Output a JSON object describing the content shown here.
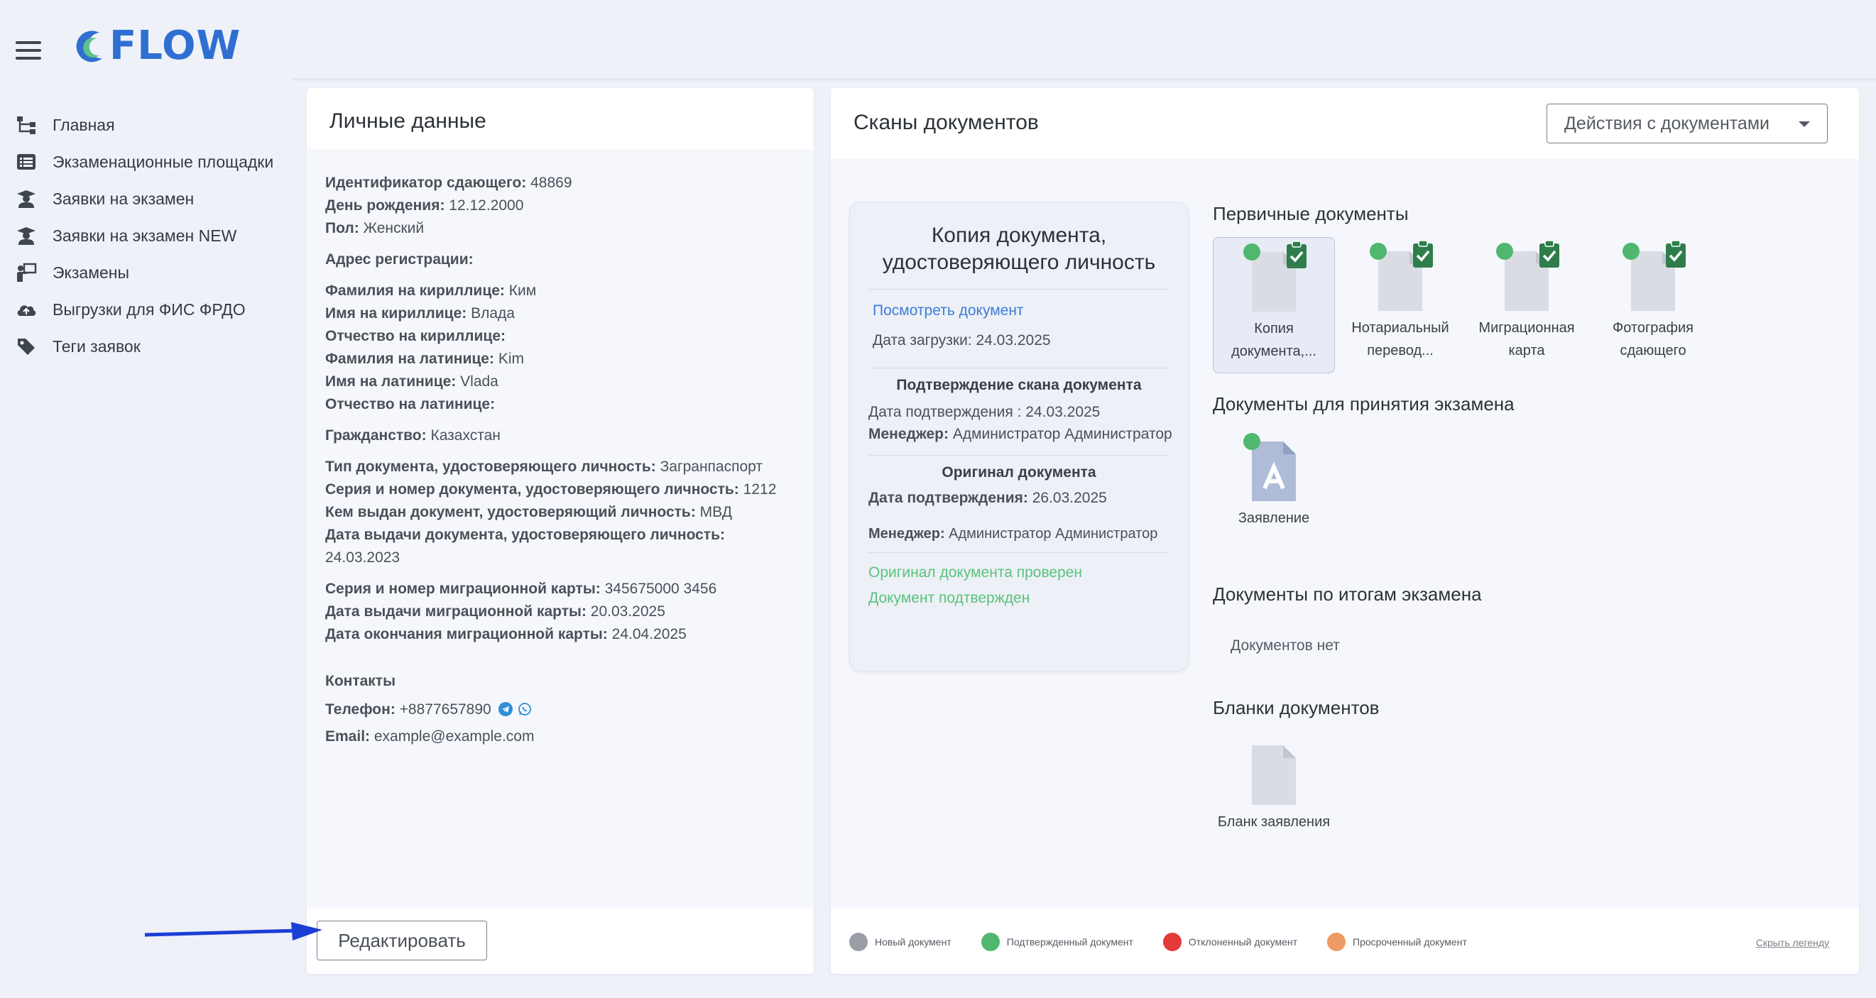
{
  "app": {
    "logo_text": "FLOW",
    "brand_color": "#2f6fd1"
  },
  "sidebar": {
    "items": [
      {
        "label": "Главная",
        "icon": "sitemap-icon"
      },
      {
        "label": "Экзаменационные площадки",
        "icon": "list-icon"
      },
      {
        "label": "Заявки на экзамен",
        "icon": "user-graduate-icon"
      },
      {
        "label": "Заявки на экзамен NEW",
        "icon": "user-graduate-icon"
      },
      {
        "label": "Экзамены",
        "icon": "teacher-board-icon"
      },
      {
        "label": "Выгрузки для ФИС ФРДО",
        "icon": "cloud-upload-icon"
      },
      {
        "label": "Теги заявок",
        "icon": "tag-icon"
      }
    ]
  },
  "personal": {
    "title": "Личные данные",
    "id_label": "Идентификатор сдающего:",
    "id_value": "48869",
    "birthday_label": "День рождения:",
    "birthday_value": "12.12.2000",
    "gender_label": "Пол:",
    "gender_value": "Женский",
    "address_label": "Адрес регистрации:",
    "last_cyr_label": "Фамилия на кириллице:",
    "last_cyr_value": "Ким",
    "first_cyr_label": "Имя на кириллице:",
    "first_cyr_value": "Влада",
    "patr_cyr_label": "Отчество на кириллице:",
    "last_lat_label": "Фамилия на латинице:",
    "last_lat_value": "Kim",
    "first_lat_label": "Имя на латинице:",
    "first_lat_value": "Vlada",
    "patr_lat_label": "Отчество на латинице:",
    "citizenship_label": "Гражданство:",
    "citizenship_value": "Казахстан",
    "doc_type_label": "Тип документа, удостоверяющего личность:",
    "doc_type_value": "Загранпаспорт",
    "doc_number_label": "Серия и номер документа, удостоверяющего личность:",
    "doc_number_value": "1212",
    "issued_by_label": "Кем выдан документ, удостоверяющий личность:",
    "issued_by_value": "МВД",
    "issue_date_label": "Дата выдачи документа, удостоверяющего личность:",
    "issue_date_value": "24.03.2023",
    "mig_number_label": "Серия и номер миграционной карты:",
    "mig_number_value": "345675000 3456",
    "mig_issue_label": "Дата выдачи миграционной карты:",
    "mig_issue_value": "20.03.2025",
    "mig_end_label": "Дата окончания миграционной карты:",
    "mig_end_value": "24.04.2025",
    "contacts_title": "Контакты",
    "phone_label": "Телефон:",
    "phone_value": "+8877657890",
    "email_label": "Email:",
    "email_value": "example@example.com",
    "edit_button": "Редактировать"
  },
  "scans": {
    "title": "Сканы документов",
    "actions_button": "Действия с документами",
    "detail": {
      "title_line1": "Копия документа,",
      "title_line2": "удостоверяющего личность",
      "view_link": "Посмотреть документ",
      "upload_date": "Дата загрузки: 24.03.2025",
      "scan_confirm_title": "Подтверждение скана документа",
      "scan_confirm_date": "Дата подтверждения : 24.03.2025",
      "manager_label": "Менеджер:",
      "scan_manager": "Администратор Администратор",
      "original_title": "Оригинал документа",
      "original_date_label": "Дата подтверждения:",
      "original_date_value": "26.03.2025",
      "original_manager": "Администратор Администратор",
      "status_checked": "Оригинал документа проверен",
      "status_confirmed": "Документ подтвержден"
    },
    "primary": {
      "title": "Первичные документы",
      "docs": [
        {
          "label_1": "Копия",
          "label_2": "документа,..."
        },
        {
          "label_1": "Нотариальный",
          "label_2": "перевод..."
        },
        {
          "label_1": "Миграционная",
          "label_2": "карта"
        },
        {
          "label_1": "Фотография",
          "label_2": "сдающего"
        }
      ]
    },
    "exam_docs": {
      "title": "Документы для принятия экзамена",
      "docs": [
        {
          "label": "Заявление"
        }
      ]
    },
    "result_docs": {
      "title": "Документы по итогам экзамена",
      "empty": "Документов нет"
    },
    "blanks": {
      "title": "Бланки документов",
      "docs": [
        {
          "label": "Бланк заявления"
        }
      ]
    },
    "legend": {
      "items": [
        {
          "label": "Новый документ",
          "color": "#9a9ea6"
        },
        {
          "label": "Подтвержденный документ",
          "color": "#4fb86e"
        },
        {
          "label": "Отклоненный документ",
          "color": "#e33a3a"
        },
        {
          "label": "Просроченный документ",
          "color": "#ee9a63"
        }
      ],
      "hide_link": "Скрыть легенду"
    }
  },
  "colors": {
    "status_green": "#4fb86e",
    "check_dark_green": "#2f7d4a",
    "file_gray": "#d9dde3",
    "link_blue": "#3b7dd8",
    "confirmed_text": "#59c37d"
  }
}
